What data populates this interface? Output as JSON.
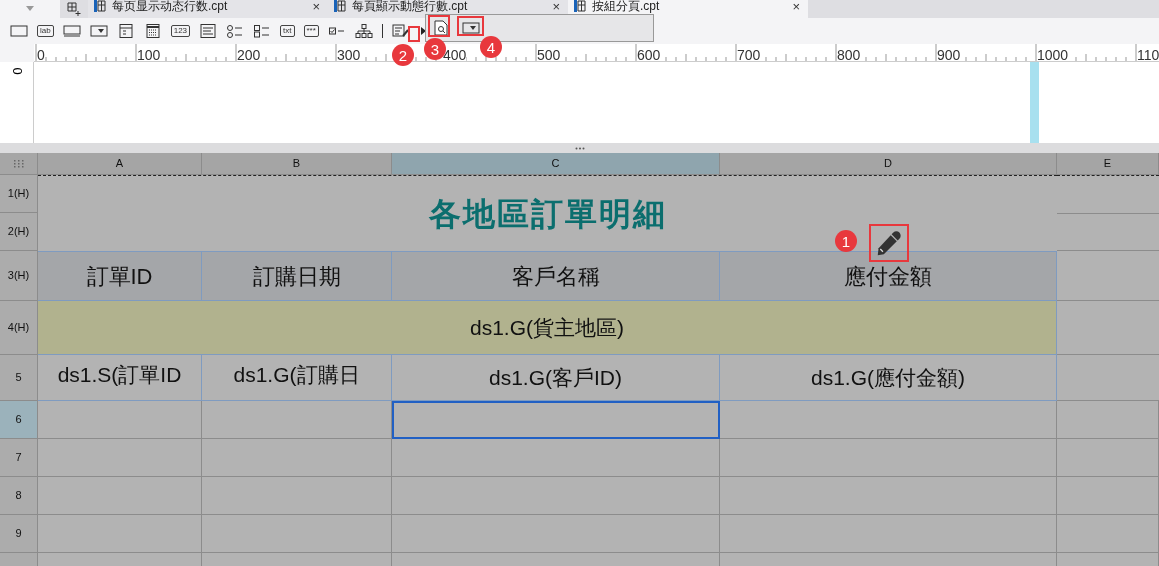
{
  "tabs": [
    {
      "title": "每页显示动态行数.cpt",
      "close": "×",
      "selected": false
    },
    {
      "title": "每頁顯示動態行數.cpt",
      "close": "×",
      "selected": false
    },
    {
      "title": "按組分頁.cpt",
      "close": "×",
      "selected": true
    }
  ],
  "toolbar": [
    {
      "kind": "button"
    },
    {
      "kind": "label",
      "label": "lab"
    },
    {
      "kind": "textfield"
    },
    {
      "kind": "combo"
    },
    {
      "kind": "form"
    },
    {
      "kind": "calendar"
    },
    {
      "kind": "label",
      "label": "123"
    },
    {
      "kind": "textarea"
    },
    {
      "kind": "radio"
    },
    {
      "kind": "checkbox"
    },
    {
      "kind": "label",
      "label": "txt"
    },
    {
      "kind": "label",
      "label": "***"
    },
    {
      "kind": "toggle"
    },
    {
      "kind": "tree"
    },
    {
      "kind": "separator"
    },
    {
      "kind": "list"
    },
    {
      "kind": "expand"
    }
  ],
  "popup": [
    {
      "kind": "preview"
    },
    {
      "kind": "combo"
    }
  ],
  "ruler": [
    "0",
    "100",
    "200",
    "300",
    "400",
    "500",
    "600",
    "700",
    "800",
    "900",
    "1000",
    "110"
  ],
  "vertical_ruler": "0",
  "sheet": {
    "columns": [
      {
        "label": "A",
        "selected": false
      },
      {
        "label": "B",
        "selected": false
      },
      {
        "label": "C",
        "selected": true
      },
      {
        "label": "D",
        "selected": false
      },
      {
        "label": "E",
        "selected": false
      }
    ],
    "rows": [
      {
        "label": "1(H)",
        "selected": false
      },
      {
        "label": "2(H)",
        "selected": false
      },
      {
        "label": "3(H)",
        "selected": false
      },
      {
        "label": "4(H)",
        "selected": false
      },
      {
        "label": "5",
        "selected": false
      },
      {
        "label": "6",
        "selected": true
      },
      {
        "label": "7",
        "selected": false
      },
      {
        "label": "8",
        "selected": false
      },
      {
        "label": "9",
        "selected": false
      }
    ],
    "title": "各地區訂單明細",
    "headers": [
      "訂單ID",
      "訂購日期",
      "客戶名稱",
      "應付金額"
    ],
    "group": "ds1.G(貨主地區)",
    "fields": [
      "ds1.S(訂單ID",
      "ds1.G(訂購日",
      "ds1.G(客戶ID)",
      "ds1.G(應付金額)"
    ],
    "blank_rows": [
      {
        "cells": [
          {
            "selected": false
          },
          {
            "selected": false
          },
          {
            "selected": true
          },
          {
            "selected": false
          },
          {
            "selected": false
          }
        ]
      },
      {
        "cells": [
          {
            "selected": false
          },
          {
            "selected": false
          },
          {
            "selected": false
          },
          {
            "selected": false
          },
          {
            "selected": false
          }
        ]
      },
      {
        "cells": [
          {
            "selected": false
          },
          {
            "selected": false
          },
          {
            "selected": false
          },
          {
            "selected": false
          },
          {
            "selected": false
          }
        ]
      },
      {
        "cells": [
          {
            "selected": false
          },
          {
            "selected": false
          },
          {
            "selected": false
          },
          {
            "selected": false
          },
          {
            "selected": false
          }
        ]
      },
      {
        "cells": [
          {
            "selected": false
          },
          {
            "selected": false
          },
          {
            "selected": false
          },
          {
            "selected": false
          },
          {
            "selected": false
          }
        ]
      }
    ]
  },
  "callouts": [
    "1",
    "2",
    "3",
    "4"
  ]
}
